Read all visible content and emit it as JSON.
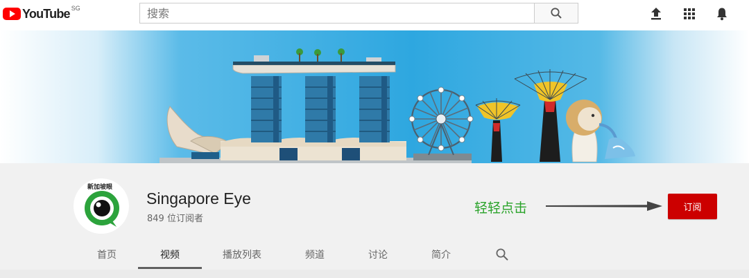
{
  "header": {
    "logo_text": "YouTube",
    "country_code": "SG",
    "search_placeholder": "搜索",
    "icons": [
      "youtube-logo",
      "search-icon",
      "upload-icon",
      "apps-grid-icon",
      "notifications-bell-icon"
    ]
  },
  "channel": {
    "avatar_label": "新加坡眼",
    "name": "Singapore Eye",
    "subscribers": "849 位订阅者",
    "subscribe_label": "订阅",
    "annotation": "轻轻点击"
  },
  "tabs": [
    {
      "label": "首页",
      "active": false
    },
    {
      "label": "视频",
      "active": true
    },
    {
      "label": "播放列表",
      "active": false
    },
    {
      "label": "频道",
      "active": false
    },
    {
      "label": "讨论",
      "active": false
    },
    {
      "label": "简介",
      "active": false
    }
  ],
  "colors": {
    "brand_red": "#ff0000",
    "subscribe_red": "#cc0000",
    "annotation_green": "#2aa32a",
    "avatar_green": "#2ca33c",
    "banner_sky": "#2ea7e0"
  }
}
